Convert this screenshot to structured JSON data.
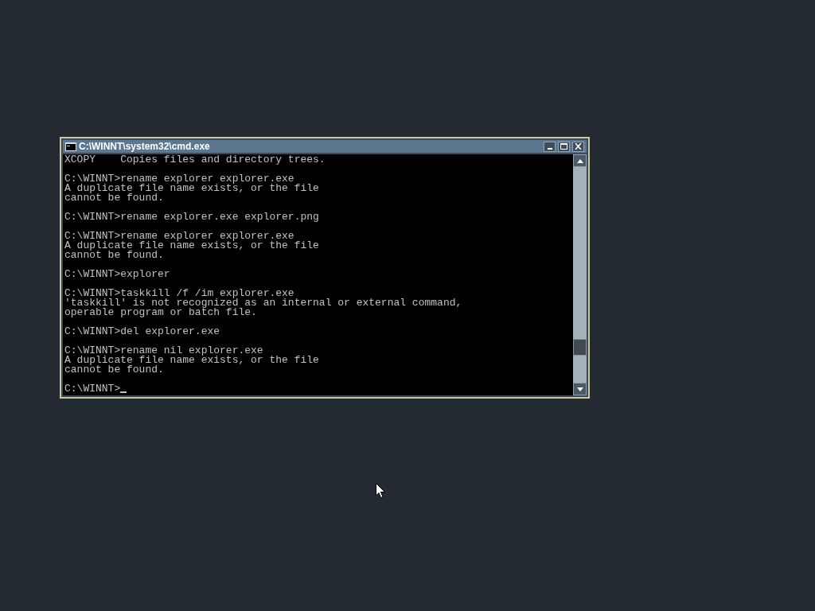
{
  "window": {
    "title": "C:\\WINNT\\system32\\cmd.exe"
  },
  "console": {
    "blocks": [
      [
        "XCOPY    Copies files and directory trees."
      ],
      [
        "C:\\WINNT>rename explorer explorer.exe",
        "A duplicate file name exists, or the file",
        "cannot be found."
      ],
      [
        "C:\\WINNT>rename explorer.exe explorer.png"
      ],
      [
        "C:\\WINNT>rename explorer explorer.exe",
        "A duplicate file name exists, or the file",
        "cannot be found."
      ],
      [
        "C:\\WINNT>explorer"
      ],
      [
        "C:\\WINNT>taskkill /f /im explorer.exe",
        "'taskkill' is not recognized as an internal or external command,",
        "operable program or batch file."
      ],
      [
        "C:\\WINNT>del explorer.exe"
      ],
      [
        "C:\\WINNT>rename nil explorer.exe",
        "A duplicate file name exists, or the file",
        "cannot be found."
      ]
    ],
    "prompt": "C:\\WINNT>"
  }
}
